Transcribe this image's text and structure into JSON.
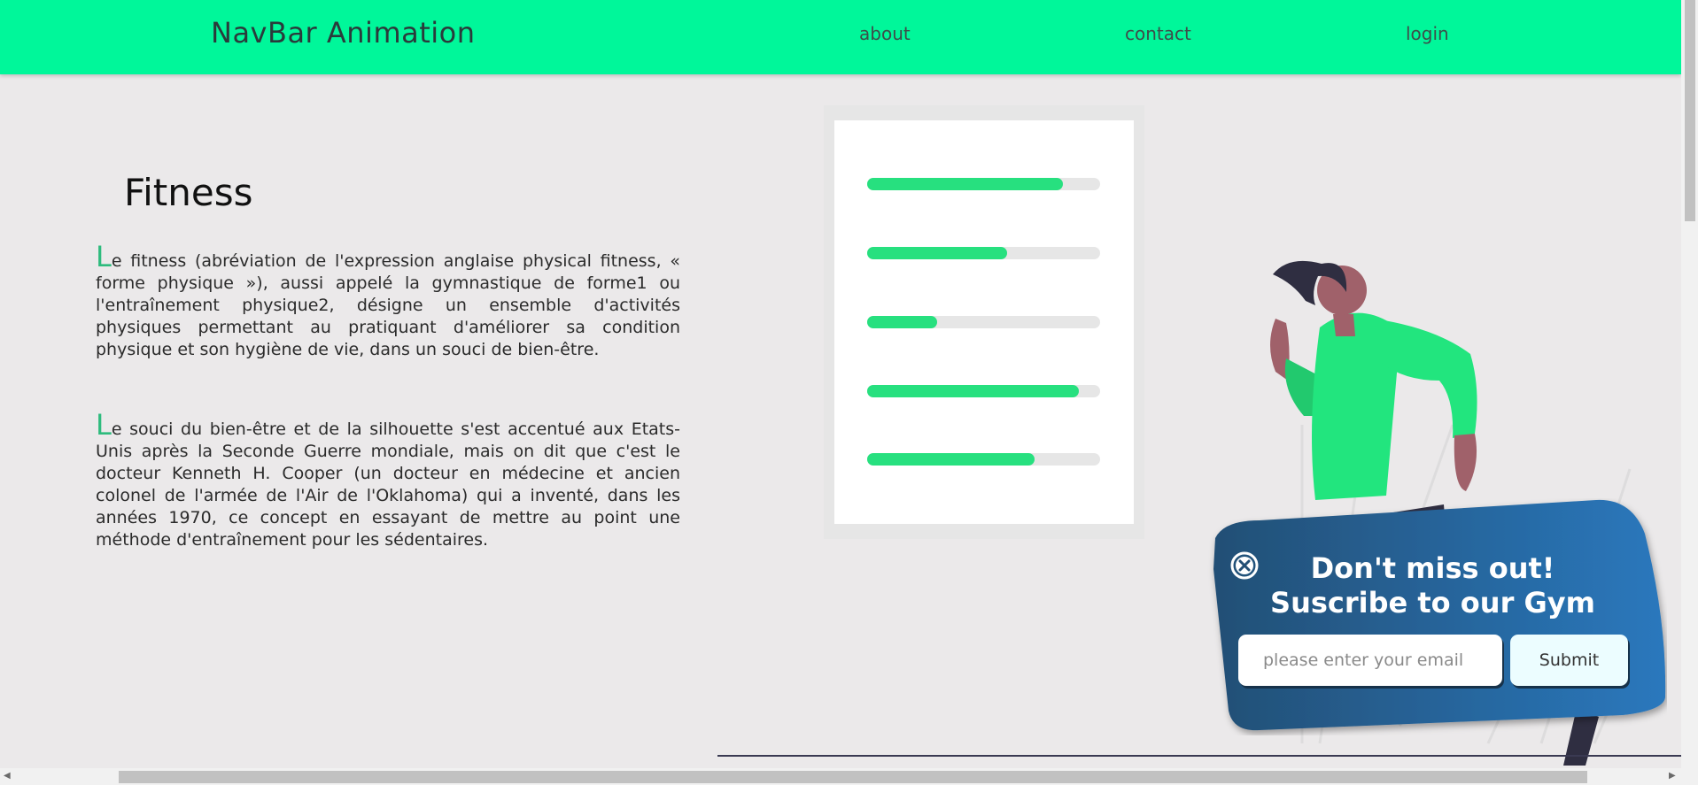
{
  "navbar": {
    "brand": "NavBar Animation",
    "links": [
      "about",
      "contact",
      "login"
    ]
  },
  "article": {
    "title": "Fitness",
    "paragraphs": [
      {
        "dropcap": "L",
        "text": "e fitness (abréviation de l'expression anglaise physical fitness, « forme physique »), aussi appelé la gymnastique de forme1 ou l'entraînement physique2, désigne un ensemble d'activités physiques permettant au pratiquant d'améliorer sa condition physique et son hygiène de vie, dans un souci de bien-être."
      },
      {
        "dropcap": "L",
        "text": "e souci du bien-être et de la silhouette s'est accentué aux Etats-Unis après la Seconde Guerre mondiale, mais on dit que c'est le docteur Kenneth H. Cooper (un docteur en médecine et ancien colonel de l'armée de l'Air de l'Oklahoma) qui a inventé, dans les années 1970, ce concept en essayant de mettre au point une méthode d'entraînement pour les sédentaires."
      }
    ]
  },
  "progress_card": {
    "bar_fill_fractions": [
      0.84,
      0.6,
      0.3,
      0.91,
      0.72
    ],
    "fill_color": "#27e07f",
    "track_color": "#e6e6e6"
  },
  "popup": {
    "close_icon": "close-circle-icon",
    "title_line1": "Don't miss out!",
    "title_line2": "Suscribe to our Gym",
    "email_placeholder": "please enter your email",
    "submit_label": "Submit",
    "colors": {
      "gradient_start": "#234f75",
      "gradient_end": "#2a78bd"
    }
  },
  "colors": {
    "navbar": "#00f79a",
    "background": "#ebe9ea",
    "accent": "#27e07f"
  }
}
